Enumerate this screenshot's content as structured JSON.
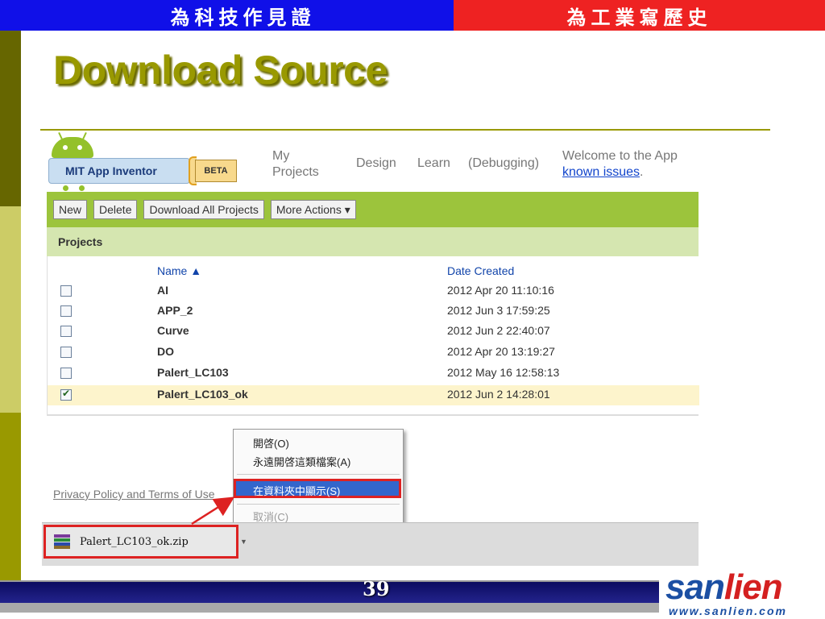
{
  "slide": {
    "banner_left": "為科技作見證",
    "banner_right": "為工業寫歷史",
    "title": "Download Source",
    "page_number": "39"
  },
  "app": {
    "logo_text": "MIT App Inventor",
    "beta_label": "BETA",
    "nav": {
      "my_projects": "My Projects",
      "design": "Design",
      "learn": "Learn",
      "debugging": "(Debugging)"
    },
    "welcome_text": "Welcome to the App",
    "known_issues_link": "known issues",
    "welcome_suffix": ".",
    "toolbar": {
      "new": "New",
      "delete": "Delete",
      "download_all": "Download All Projects",
      "more_actions": "More Actions ▾"
    },
    "projects_header": "Projects",
    "table": {
      "col_name": "Name ▲",
      "col_date": "Date Created",
      "rows": [
        {
          "name": "AI",
          "date": "2012 Apr 20 11:10:16",
          "checked": false
        },
        {
          "name": "APP_2",
          "date": "2012 Jun 3 17:59:25",
          "checked": false
        },
        {
          "name": "Curve",
          "date": "2012 Jun 2 22:40:07",
          "checked": false
        },
        {
          "name": "DO",
          "date": "2012 Apr 20 13:19:27",
          "checked": false
        },
        {
          "name": "Palert_LC103",
          "date": "2012 May 16 12:58:13",
          "checked": false
        },
        {
          "name": "Palert_LC103_ok",
          "date": "2012 Jun 2 14:28:01",
          "checked": true
        }
      ]
    },
    "privacy_link": "Privacy Policy and Terms of Use"
  },
  "context_menu": {
    "open": "開啓(O)",
    "always_open": "永遠開啓這類檔案(A)",
    "show_in_folder": "在資料夾中顯示(S)",
    "cancel": "取消(C)"
  },
  "download_bar": {
    "file_name": "Palert_LC103_ok.zip"
  },
  "brand": {
    "name_part1": "san",
    "name_part2": "lien",
    "url": "www.sanlien.com"
  },
  "colors": {
    "banner_left": "#1010e8",
    "banner_right": "#ee2222",
    "title_olive": "#999900",
    "toolbar_green": "#9cc43c",
    "highlight_red": "#dd2222"
  }
}
